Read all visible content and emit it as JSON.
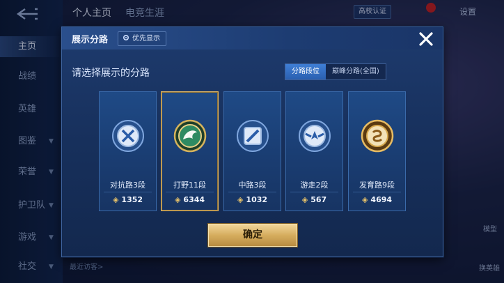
{
  "topbar": {
    "tabs": [
      "个人主页",
      "电竞生涯"
    ],
    "notice": "",
    "verify_label": "高校认证",
    "settings_label": "设置"
  },
  "sidebar": {
    "items": [
      {
        "label": "主页",
        "active": true,
        "chevron": false
      },
      {
        "label": "战绩",
        "active": false,
        "chevron": false
      },
      {
        "label": "英雄",
        "active": false,
        "chevron": false
      },
      {
        "label": "图鉴",
        "active": false,
        "chevron": true
      },
      {
        "label": "荣誉",
        "active": false,
        "chevron": true
      },
      {
        "label": "护卫队",
        "active": false,
        "chevron": true
      },
      {
        "label": "游戏",
        "active": false,
        "chevron": true
      },
      {
        "label": "社交",
        "active": false,
        "chevron": true
      }
    ]
  },
  "background": {
    "recent_visitors": "最近访客>",
    "model_label": "模型",
    "swap_label": "换英雄"
  },
  "dialog": {
    "title": "展示分路",
    "priority_label": "优先显示",
    "prompt": "请选择展示的分路",
    "segments": [
      {
        "label": "分路段位",
        "on": true
      },
      {
        "label": "巅峰分路(全国)",
        "on": false
      }
    ],
    "cards": [
      {
        "name": "对抗路3段",
        "score": "1352",
        "icon": "shield-swords-icon",
        "selected": false
      },
      {
        "name": "打野11段",
        "score": "6344",
        "icon": "jungle-dragon-icon",
        "selected": true
      },
      {
        "name": "中路3段",
        "score": "1032",
        "icon": "mid-lane-icon",
        "selected": false
      },
      {
        "name": "游走2段",
        "score": "567",
        "icon": "support-wings-icon",
        "selected": false
      },
      {
        "name": "发育路9段",
        "score": "4694",
        "icon": "farm-lane-icon",
        "selected": false
      }
    ],
    "confirm_label": "确定"
  },
  "colors": {
    "gold": "#e0b766",
    "panel": "#1a3d72",
    "accent_blue": "#3f7fd6"
  }
}
